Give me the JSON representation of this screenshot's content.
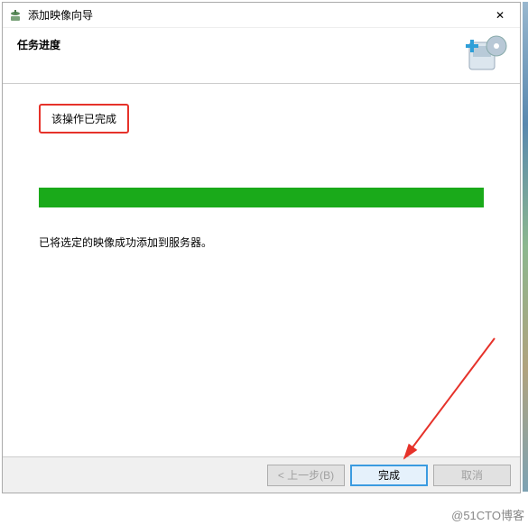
{
  "window": {
    "title": "添加映像向导",
    "close_symbol": "✕"
  },
  "header": {
    "title": "任务进度"
  },
  "content": {
    "status": "该操作已完成",
    "message": "已将选定的映像成功添加到服务器。"
  },
  "footer": {
    "back_label": "< 上一步(B)",
    "finish_label": "完成",
    "cancel_label": "取消"
  },
  "watermark": "@51CTO博客"
}
